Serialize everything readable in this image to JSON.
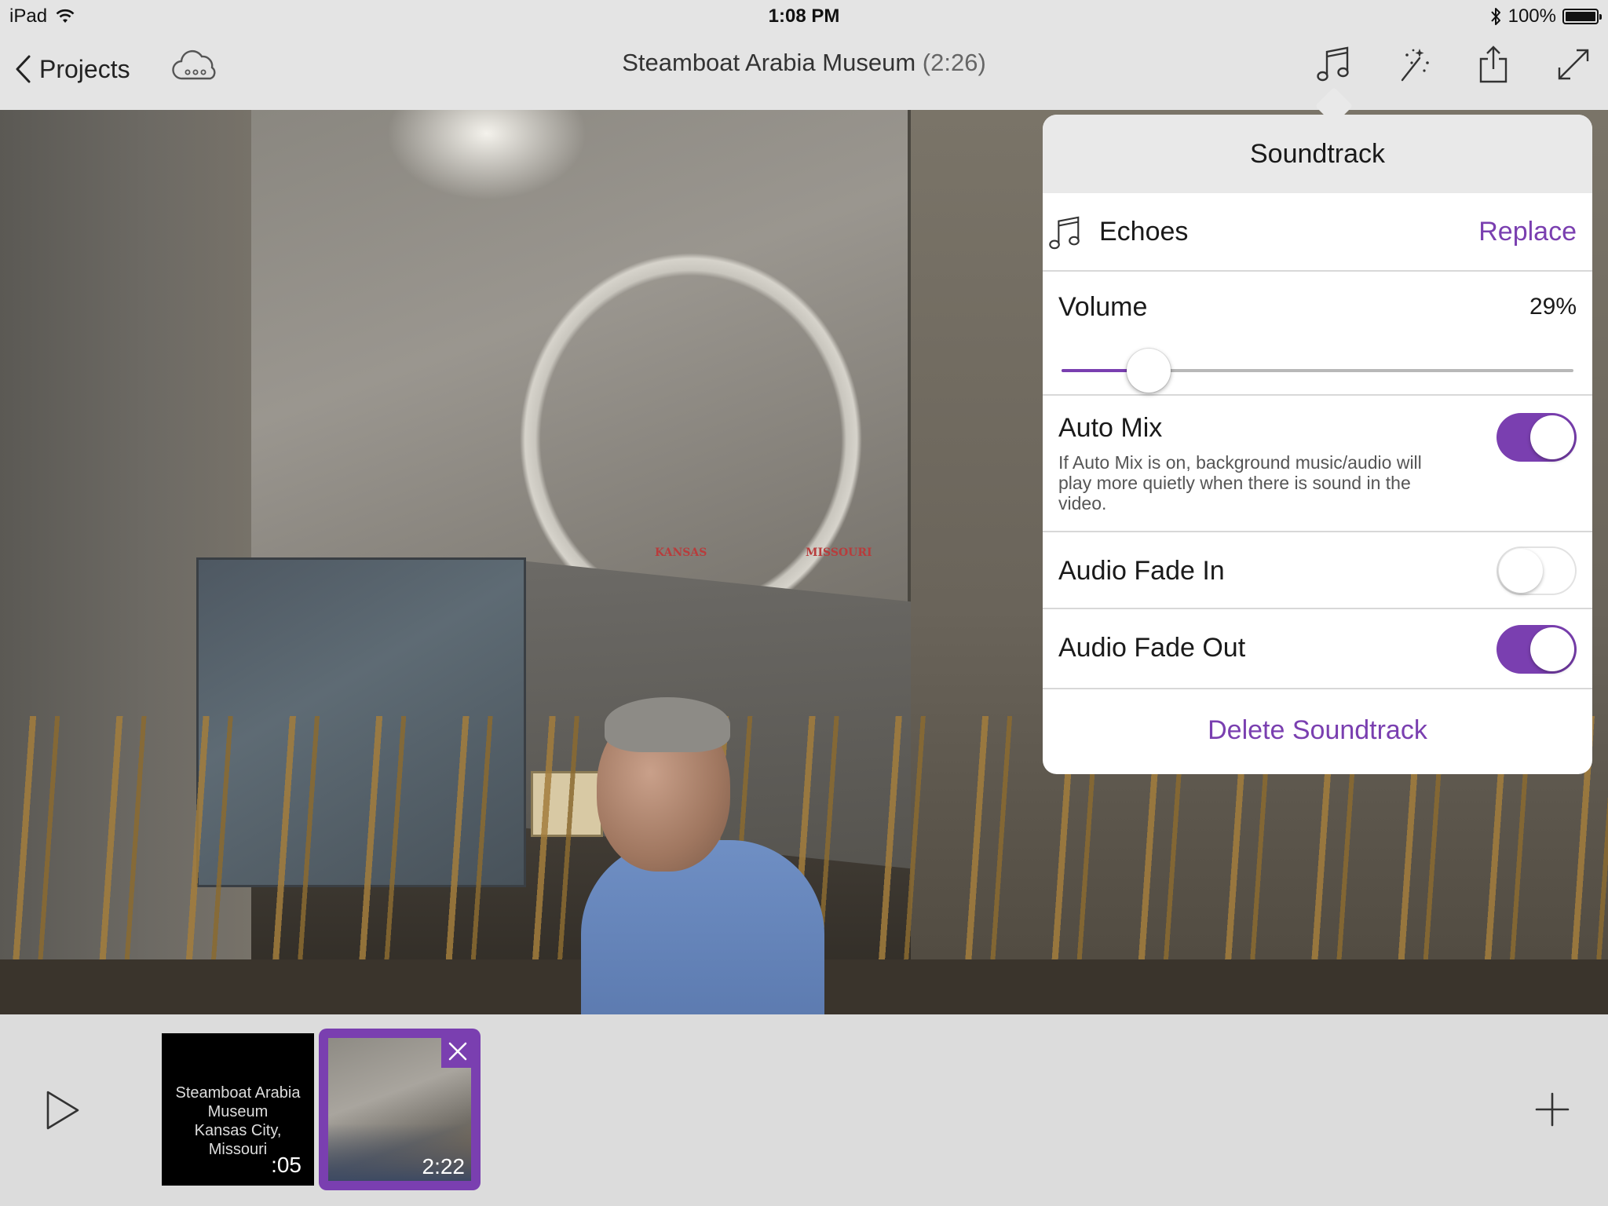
{
  "status_bar": {
    "device": "iPad",
    "time": "1:08 PM",
    "battery": "100%",
    "battery_level": 1.0,
    "icons": [
      "wifi-icon",
      "bluetooth-icon",
      "battery-icon"
    ]
  },
  "nav": {
    "back_label": "Projects",
    "title": "Steamboat Arabia Museum",
    "duration": "(2:26)",
    "icons": [
      "cloud-sync-icon",
      "music-note-icon",
      "magic-wand-icon",
      "share-icon",
      "expand-icon"
    ]
  },
  "soundtrack": {
    "header": "Soundtrack",
    "track_name": "Echoes",
    "replace_label": "Replace",
    "volume_label": "Volume",
    "volume_value": "29%",
    "volume_level": 0.17,
    "auto_mix": {
      "label": "Auto Mix",
      "description": "If Auto Mix is on, background music/audio will play more quietly when there is sound in the video.",
      "on": true
    },
    "fade_in": {
      "label": "Audio Fade In",
      "on": false
    },
    "fade_out": {
      "label": "Audio Fade Out",
      "on": true
    },
    "delete_label": "Delete Soundtrack"
  },
  "video_labels": {
    "kansas": "KANSAS",
    "missouri": "MISSOURI"
  },
  "timeline": {
    "clips": [
      {
        "title_lines": [
          "Steamboat Arabia",
          "Museum",
          "Kansas City, Missouri"
        ],
        "duration": ":05"
      },
      {
        "duration": "2:22",
        "selected": true
      }
    ]
  },
  "colors": {
    "accent": "#7a3fb0",
    "bar_bg": "#e4e4e4",
    "timeline_bg": "#dcdcdc"
  }
}
